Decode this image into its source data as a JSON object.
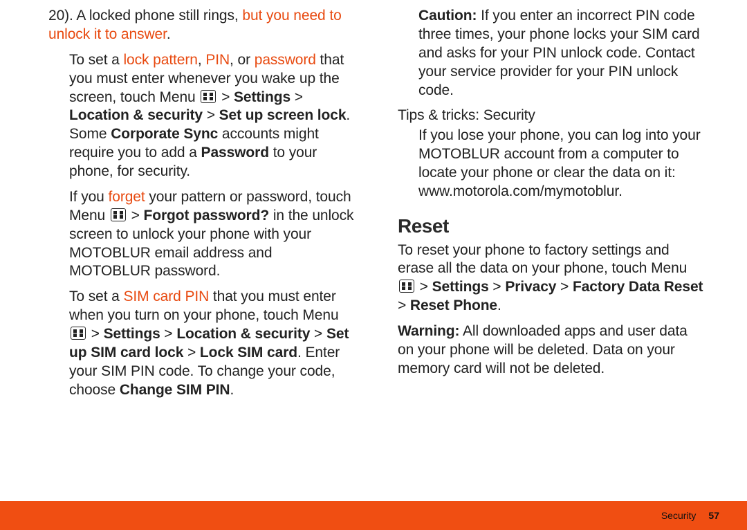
{
  "left": {
    "p1a": "20). A locked phone still rings, ",
    "p1b": "but you need to unlock it to answer",
    "p1c": ".",
    "p2a": "To set a ",
    "p2b": "lock pattern",
    "p2c": ", ",
    "p2d": "PIN",
    "p2e": ", or ",
    "p2f": "password",
    "p2g": " that you must enter whenever you wake up the screen, touch Menu ",
    "p2h": " > ",
    "p2i": "Settings",
    "p2j": " > ",
    "p2k": "Location & security",
    "p2l": " > ",
    "p2m": "Set up screen lock",
    "p2n": ". Some ",
    "p2o": "Corporate Sync",
    "p2p": " accounts might require you to add a ",
    "p2q": "Password",
    "p2r": " to your phone, for security.",
    "p3a": "If you ",
    "p3b": "forget",
    "p3c": " your pattern or password, touch Menu ",
    "p3d": " > ",
    "p3e": "Forgot password?",
    "p3f": " in the unlock screen to unlock your phone with your MOTOBLUR email address and MOTOBLUR password.",
    "p4a": "To set a ",
    "p4b": "SIM card PIN",
    "p4c": " that you must enter when you turn on your phone, touch Menu ",
    "p4d": " > ",
    "p4e": "Settings",
    "p4f": " > ",
    "p4g": "Location & security",
    "p4h": " > ",
    "p4i": "Set up SIM card lock",
    "p4j": " > ",
    "p4k": "Lock SIM card",
    "p4l": ". Enter your SIM PIN code. To change your code, choose ",
    "p4m": "Change SIM PIN",
    "p4n": "."
  },
  "right": {
    "p1a": "Caution:",
    "p1b": " If you enter an incorrect PIN code three times, your phone locks your SIM card and asks for your PIN unlock code. Contact your service provider for your PIN unlock code.",
    "subhead": "Tips & tricks: Security",
    "p2a": "If you lose your phone, you can log into your MOTOBLUR account from a computer to locate your phone or clear the data on it: ",
    "p2b": "www.motorola.com/mymotoblur",
    "p2c": ".",
    "reset_heading": "Reset",
    "p3a": "To reset your phone to factory settings and erase all the data on your phone, touch Menu ",
    "p3b": " > ",
    "p3c": "Settings",
    "p3d": " > ",
    "p3e": "Privacy",
    "p3f": " > ",
    "p3g": "Factory Data Reset",
    "p3h": " > ",
    "p3i": "Reset Phone",
    "p3j": ".",
    "p4a": "Warning:",
    "p4b": " All downloaded apps and user data on your phone will be deleted. Data on your memory card will not be deleted."
  },
  "footer": {
    "section": "Security",
    "page": "57"
  }
}
